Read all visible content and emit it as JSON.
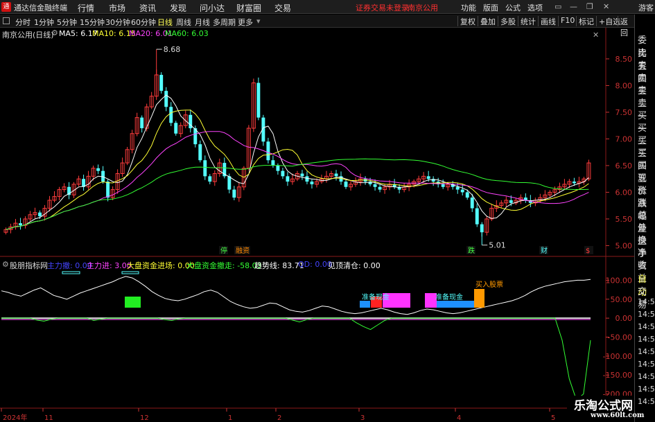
{
  "menubar": {
    "logo_glyph": "通",
    "app_title": "通达信金融终端",
    "items": [
      "行情",
      "市场",
      "资讯",
      "发现",
      "问小达",
      "财富圈",
      "交易"
    ],
    "login_status": "证券交易未登录",
    "broker": "南京公用",
    "right_items": [
      "功能",
      "版面",
      "公式",
      "选项"
    ],
    "guest": "游客"
  },
  "toolbar": {
    "periods": [
      "分时",
      "1分钟",
      "5分钟",
      "15分钟",
      "30分钟",
      "60分钟",
      "日线",
      "周线",
      "月线",
      "多周期",
      "更多"
    ],
    "active_period": "日线",
    "buttons": [
      "复权",
      "叠加",
      "多股",
      "统计",
      "画线",
      "F10",
      "标记",
      "+自选",
      "返回"
    ]
  },
  "right_panel": {
    "items": [
      "委比",
      "卖五",
      "卖四",
      "卖三",
      "卖二",
      "卖一",
      "买一",
      "买二",
      "买三",
      "买四",
      "买五",
      "现价",
      "涨跌",
      "涨幅",
      "总量",
      "外盘",
      "换手",
      "净资",
      "收益"
    ],
    "auto_label": "自动",
    "trade_label": "交易",
    "times": [
      "14:56",
      "14:56",
      "14:56",
      "14:56",
      "14:56",
      "14:56",
      "14:56",
      "14:56",
      "14:56",
      "14:56"
    ]
  },
  "main_chart": {
    "title": "南京公用(日线)",
    "legend": [
      {
        "label": "MA5: 6.17",
        "color": "#ffffff"
      },
      {
        "label": "MA10: 6.15",
        "color": "#ffff33"
      },
      {
        "label": "MA20: 6.01",
        "color": "#ff44ff"
      },
      {
        "label": "MA60: 6.03",
        "color": "#33ff33"
      }
    ],
    "high_label": "8.68",
    "low_label": "5.01",
    "markers": [
      "停",
      "融资",
      "跌",
      "财",
      "$"
    ]
  },
  "indicator": {
    "title": "股朋指标网",
    "legend": [
      {
        "label": "主力撤: 0.00",
        "color": "#4444ff"
      },
      {
        "label": "主力进: 3.00",
        "color": "#ff44ff"
      },
      {
        "label": "大盘资金进场: 0.00",
        "color": "#ffff33"
      },
      {
        "label": "大盘资金撤走: -58.03",
        "color": "#33ff33"
      },
      {
        "label": "趋势线: 83.71",
        "color": "#ffffff"
      },
      {
        "label": "QD: 0.00",
        "color": "#4444ff"
      },
      {
        "label": "见顶清仓: 0.00",
        "color": "#ffffff"
      }
    ],
    "annotations": [
      "准备现金",
      "准备现金",
      "买入股票"
    ]
  },
  "chart_data": [
    {
      "type": "candlestick",
      "title": "南京公用(日线)",
      "y_axis_ticks": [
        8.5,
        8.0,
        7.5,
        7.0,
        6.5,
        6.0,
        5.5,
        5.0
      ],
      "ylim": [
        4.85,
        8.85
      ],
      "x_tick_labels": [
        "2024年",
        "11",
        "12",
        "1",
        "2",
        "3",
        "4",
        "5"
      ],
      "close_series": [
        5.3,
        5.35,
        5.42,
        5.38,
        5.5,
        5.58,
        5.62,
        5.55,
        5.7,
        5.85,
        5.92,
        6.05,
        6.1,
        5.95,
        6.15,
        6.25,
        6.1,
        6.3,
        6.45,
        6.4,
        6.2,
        5.9,
        6.05,
        6.35,
        6.55,
        6.8,
        7.1,
        7.4,
        7.2,
        7.6,
        7.8,
        8.2,
        7.9,
        7.6,
        7.3,
        7.1,
        7.25,
        7.45,
        7.2,
        6.9,
        6.6,
        6.3,
        6.2,
        6.35,
        6.55,
        6.3,
        6.05,
        5.9,
        6.1,
        6.45,
        7.2,
        8.05,
        7.4,
        6.95,
        6.6,
        6.5,
        6.4,
        6.3,
        6.2,
        6.25,
        6.35,
        6.3,
        6.2,
        6.15,
        6.2,
        6.25,
        6.3,
        6.35,
        6.3,
        6.2,
        6.1,
        6.15,
        6.2,
        6.25,
        6.2,
        6.15,
        6.1,
        6.05,
        6.1,
        6.15,
        6.1,
        6.05,
        6.1,
        6.15,
        6.2,
        6.25,
        6.3,
        6.25,
        6.2,
        6.15,
        6.1,
        6.15,
        6.1,
        6.05,
        6.0,
        5.9,
        5.7,
        5.4,
        5.25,
        5.5,
        5.7,
        5.75,
        5.8,
        5.85,
        5.8,
        5.85,
        5.9,
        5.85,
        5.8,
        5.85,
        5.9,
        5.95,
        6.0,
        6.05,
        6.1,
        6.15,
        6.2,
        6.17,
        6.2,
        6.25,
        6.55
      ],
      "series": [
        {
          "name": "MA5",
          "value": 6.17
        },
        {
          "name": "MA10",
          "value": 6.15
        },
        {
          "name": "MA20",
          "value": 6.01
        },
        {
          "name": "MA60",
          "value": 6.03
        }
      ],
      "annotations": [
        {
          "label": "8.68"
        },
        {
          "label": "5.01"
        }
      ]
    },
    {
      "type": "line",
      "title": "股朋指标网",
      "y_axis_ticks": [
        100.0,
        50.0,
        0.0,
        -50.0,
        -100.0,
        -150.0,
        -200.0
      ],
      "ylim": [
        -230,
        130
      ],
      "trend_series": [
        72,
        68,
        62,
        58,
        66,
        74,
        80,
        70,
        60,
        55,
        50,
        58,
        66,
        72,
        78,
        84,
        90,
        96,
        104,
        110,
        106,
        96,
        84,
        70,
        60,
        52,
        48,
        46,
        50,
        56,
        62,
        70,
        74,
        68,
        56,
        44,
        36,
        30,
        26,
        28,
        34,
        40,
        38,
        30,
        22,
        18,
        16,
        20,
        26,
        32,
        30,
        24,
        18,
        14,
        12,
        14,
        18,
        22,
        26,
        22,
        16,
        12,
        10,
        14,
        20,
        24,
        22,
        18,
        14,
        12,
        14,
        18,
        22,
        26,
        30,
        34,
        38,
        42,
        46,
        52,
        60,
        70,
        78,
        84,
        88,
        92,
        96,
        98,
        100,
        100,
        102
      ],
      "funds_out_series": [
        0,
        0,
        0,
        0,
        0,
        -5,
        -8,
        -3,
        0,
        0,
        0,
        0,
        0,
        -6,
        -3,
        0,
        0,
        0,
        0,
        0,
        0,
        0,
        0,
        -4,
        -6,
        -2,
        0,
        0,
        0,
        0,
        0,
        0,
        0,
        0,
        0,
        0,
        0,
        0,
        0,
        0,
        0,
        -5,
        -10,
        -4,
        0,
        0,
        0,
        0,
        0,
        0,
        -12,
        -22,
        -30,
        -18,
        -6,
        0,
        0,
        0,
        0,
        0,
        0,
        0,
        0,
        0,
        0,
        0,
        0,
        0,
        0,
        0,
        0,
        0,
        0,
        0,
        0,
        0,
        0,
        0,
        0,
        -58,
        -160,
        -215,
        -200,
        -58
      ],
      "series": [
        {
          "name": "主力撤",
          "value": 0.0
        },
        {
          "name": "主力进",
          "value": 3.0
        },
        {
          "name": "大盘资金进场",
          "value": 0.0
        },
        {
          "name": "大盘资金撤走",
          "value": -58.03
        },
        {
          "name": "趋势线",
          "value": 83.71
        },
        {
          "name": "QD",
          "value": 0.0
        },
        {
          "name": "见顶清仓",
          "value": 0.0
        }
      ],
      "annotations": [
        {
          "label": "准备现金"
        },
        {
          "label": "准备现金"
        },
        {
          "label": "买入股票"
        }
      ]
    }
  ],
  "watermark": {
    "line1": "乐淘公式网",
    "line2": "www.60lt.com"
  }
}
